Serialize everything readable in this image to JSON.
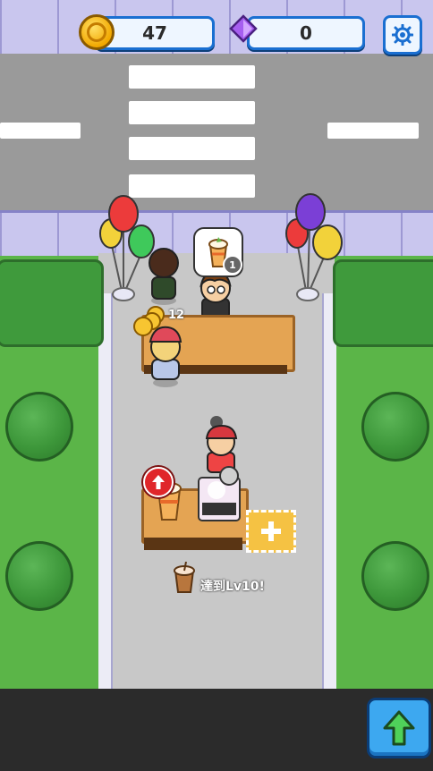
{
  "hud": {
    "coins": "47",
    "gems": "0",
    "coin_icon": "coin-icon",
    "gem_icon": "gem-icon",
    "settings_icon": "gear-icon"
  },
  "order_bubble": {
    "item_icon": "iced-drink-icon",
    "count": "1"
  },
  "tip": {
    "amount": "12",
    "icon": "coin-stack-icon"
  },
  "goal": {
    "text": "達到Lv10!",
    "icon": "drink-cup-icon"
  },
  "actions": {
    "upgrade_icon": "up-arrow-icon",
    "new_slot_icon": "plus-icon"
  },
  "colors": {
    "grass": "#5bb548",
    "road": "#9a9a9a",
    "sidewalk": "#c9c6ee",
    "hud_border": "#1a6fd1",
    "counter_wood": "#e4a453",
    "upgrade_button": "#3da8f0",
    "upgrade_arrow": "#4fd15a"
  }
}
